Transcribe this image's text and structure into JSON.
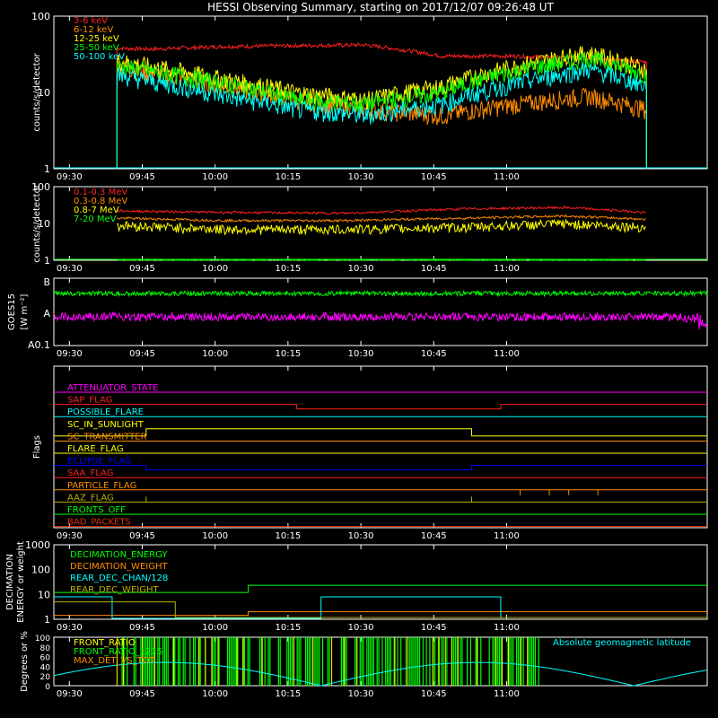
{
  "title": "HESSI Observing Summary, starting on 2017/12/07 09:26:48 UT",
  "colors": {
    "bg": "#000000",
    "axis": "#ffffff",
    "red": "#ff2020",
    "orange": "#ff8c00",
    "yellow": "#ffff00",
    "green": "#00ff00",
    "cyan": "#00ffff",
    "magenta": "#ff00ff",
    "blue": "#0000ff",
    "olive": "#b8b000",
    "darkred": "#e03000"
  },
  "time_ticks": [
    "09:30",
    "09:45",
    "10:00",
    "10:15",
    "10:30",
    "10:45",
    "11:00"
  ],
  "chart_data": [
    {
      "id": "low-energy",
      "type": "line",
      "ylabel": "counts/s/detector",
      "yscale": "log",
      "ylim": [
        1,
        100
      ],
      "yticks": [
        "1",
        "10",
        "100"
      ],
      "legend_position": "top-left",
      "x_minutes_since_0926": [
        13,
        20,
        35,
        50,
        64,
        80,
        95,
        110,
        122
      ],
      "series": [
        {
          "name": "3-6 keV",
          "color": "#ff2020",
          "values": [
            38,
            37,
            40,
            41,
            42,
            30,
            30,
            28,
            25
          ]
        },
        {
          "name": "6-12 keV",
          "color": "#ff8c00",
          "values": [
            22,
            18,
            12,
            8,
            6,
            5,
            7,
            9,
            6
          ]
        },
        {
          "name": "12-25 keV",
          "color": "#ffff00",
          "values": [
            26,
            22,
            15,
            10,
            8,
            12,
            22,
            33,
            20
          ]
        },
        {
          "name": "25-50 keV",
          "color": "#00ff00",
          "values": [
            22,
            19,
            13,
            8,
            7,
            10,
            19,
            28,
            17
          ]
        },
        {
          "name": "50-100 keV",
          "color": "#00ffff",
          "values": [
            17,
            14,
            9,
            6,
            5,
            7,
            13,
            20,
            12
          ]
        }
      ]
    },
    {
      "id": "high-energy",
      "type": "line",
      "ylabel": "counts/s/detector",
      "yscale": "log",
      "ylim": [
        1,
        100
      ],
      "yticks": [
        "1",
        "10",
        "100"
      ],
      "legend_position": "top-left",
      "x_minutes_since_0926": [
        13,
        35,
        60,
        85,
        105,
        122
      ],
      "series": [
        {
          "name": "0.1-0.3 MeV",
          "color": "#ff2020",
          "values": [
            22,
            20,
            19,
            25,
            27,
            20
          ]
        },
        {
          "name": "0.3-0.8 MeV",
          "color": "#ff8c00",
          "values": [
            14,
            12,
            12,
            14,
            16,
            13
          ]
        },
        {
          "name": "0.8-7 MeV",
          "color": "#ffff00",
          "values": [
            9,
            7,
            7,
            8,
            10,
            8
          ]
        },
        {
          "name": "7-20 MeV",
          "color": "#00ff00",
          "values": [
            1,
            1,
            1,
            1,
            1,
            1
          ]
        }
      ]
    },
    {
      "id": "goes",
      "type": "line",
      "ylabel": "GOES15",
      "yunit": "[W m⁻²]",
      "yticks": [
        "B",
        "A",
        "A0.1"
      ],
      "series": [
        {
          "name": "",
          "color": "#00ff00",
          "level": "just below B"
        },
        {
          "name": "",
          "color": "#ff00ff",
          "level": "just below A"
        }
      ]
    },
    {
      "id": "flags",
      "type": "timeline",
      "ylabel": "Flags",
      "flags": [
        {
          "name": "ATTENUATOR_STATE",
          "color": "#ff00ff"
        },
        {
          "name": "SAP_FLAG",
          "color": "#ff2020"
        },
        {
          "name": "POSSIBLE_FLARE",
          "color": "#00ffff"
        },
        {
          "name": "SC_IN_SUNLIGHT",
          "color": "#ffff00"
        },
        {
          "name": "SC_TRANSMITTER",
          "color": "#ff8c00"
        },
        {
          "name": "FLARE_FLAG",
          "color": "#ffff00"
        },
        {
          "name": "ECLIPSE_FLAG",
          "color": "#0000ff"
        },
        {
          "name": "SAA_FLAG",
          "color": "#ff2020"
        },
        {
          "name": "PARTICLE_FLAG",
          "color": "#ff8c00"
        },
        {
          "name": "AAZ_FLAG",
          "color": "#b8b000"
        },
        {
          "name": "FRONTS_OFF",
          "color": "#00ff00"
        },
        {
          "name": "BAD_PACKETS",
          "color": "#e03000"
        }
      ]
    },
    {
      "id": "decimation",
      "type": "step",
      "ylabel": "DECIMATION ENERGY or weight",
      "yscale": "log",
      "ylim": [
        1,
        1000
      ],
      "yticks": [
        "1",
        "10",
        "100",
        "1000"
      ],
      "series": [
        {
          "name": "DECIMATION_ENERGY",
          "color": "#00ff00"
        },
        {
          "name": "DECIMATION_WEIGHT",
          "color": "#ff8c00"
        },
        {
          "name": "REAR_DEC_CHAN/128",
          "color": "#00ffff"
        },
        {
          "name": "REAR_DEC_WEIGHT",
          "color": "#b8b000"
        }
      ]
    },
    {
      "id": "ratios",
      "type": "line",
      "ylabel": "Degrees or %",
      "ylim": [
        0,
        100
      ],
      "yticks": [
        "0",
        "20",
        "40",
        "60",
        "80",
        "100"
      ],
      "series": [
        {
          "name": "FRONT_RATIO",
          "color": "#ffff00"
        },
        {
          "name": "FRONT_RATIO_1225",
          "color": "#00ff00"
        },
        {
          "name": "MAX_DET_VS_TOT",
          "color": "#ff8c00"
        },
        {
          "name": "Absolute geomagnetic latitude",
          "color": "#00ffff"
        }
      ]
    }
  ]
}
